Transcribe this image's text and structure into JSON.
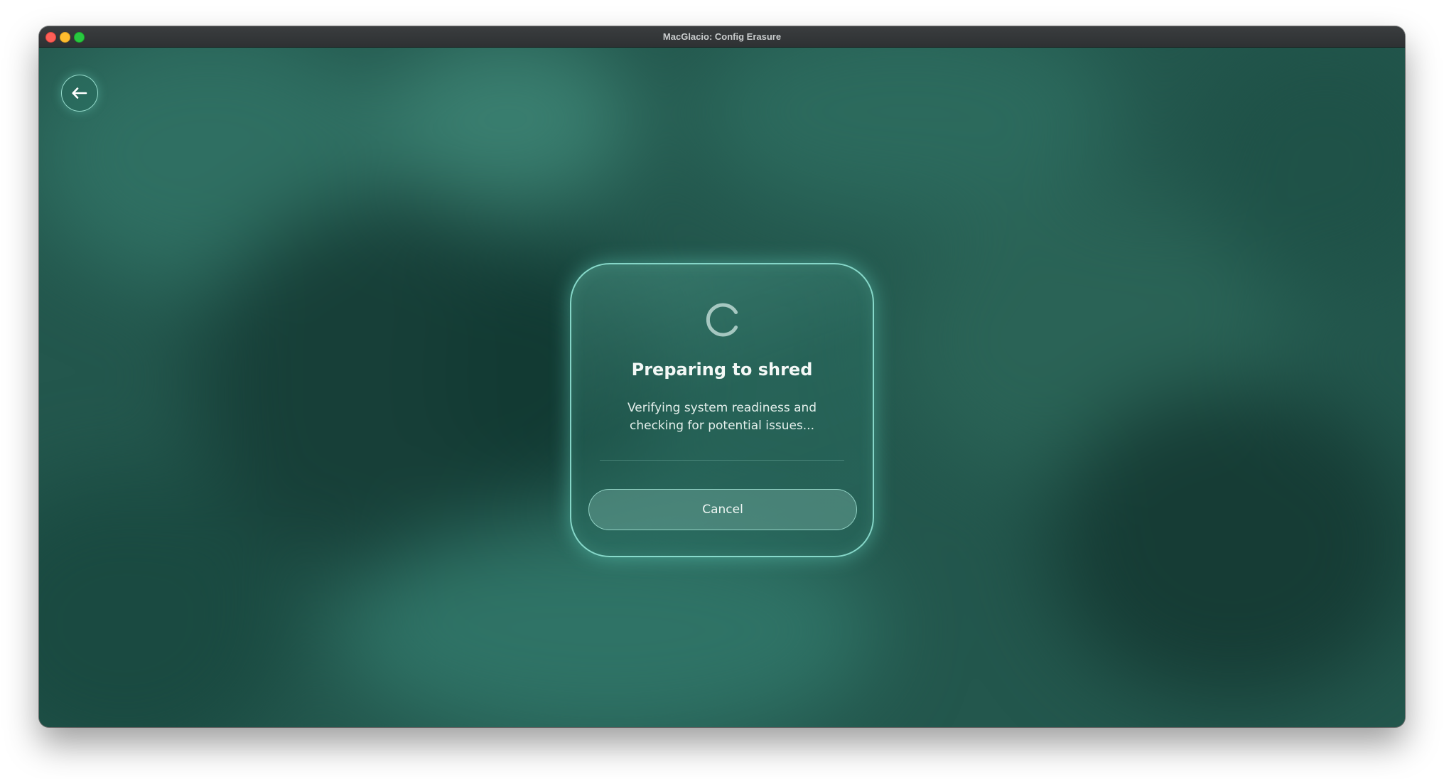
{
  "window": {
    "title": "MacGlacio: Config Erasure"
  },
  "navigation": {
    "back_icon": "arrow-left-icon"
  },
  "dialog": {
    "spinner_icon": "loading-spinner-icon",
    "title": "Preparing to shred",
    "message": "Verifying system readiness and checking for potential issues...",
    "cancel_label": "Cancel"
  },
  "colors": {
    "background": "#23574d",
    "accent_border": "#96ebdc",
    "text": "#f3f8f6"
  }
}
